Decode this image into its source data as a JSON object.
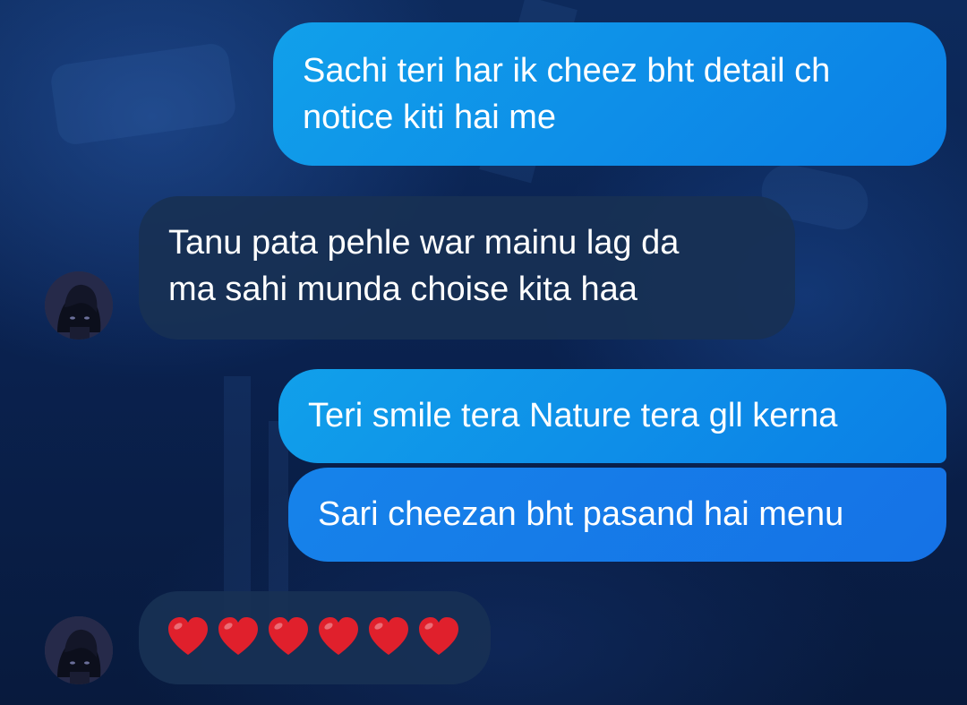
{
  "chat": {
    "messages": [
      {
        "direction": "sent",
        "lines": [
          "Sachi teri har ik cheez bht detail ch",
          "notice kiti hai me"
        ]
      },
      {
        "direction": "received",
        "lines": [
          "Tanu pata pehle war mainu lag da",
          "ma sahi munda choise kita haa"
        ]
      },
      {
        "direction": "sent",
        "lines": [
          "Teri smile tera Nature tera gll kerna"
        ]
      },
      {
        "direction": "sent",
        "lines": [
          "Sari cheezan bht pasand hai menu"
        ]
      },
      {
        "direction": "received",
        "emoji": "red-heart",
        "emoji_count": 6
      }
    ]
  },
  "colors": {
    "sent_bubble": "#0b8ae8",
    "received_bubble": "#18304f",
    "background": "#0a2250",
    "heart": "#e0202c",
    "text": "#ffffff"
  }
}
